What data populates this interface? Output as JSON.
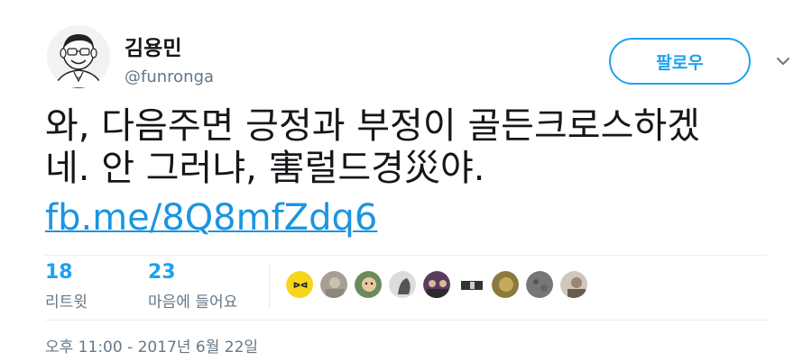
{
  "author": {
    "name": "김용민",
    "handle": "@funronga"
  },
  "follow_label": "팔로우",
  "tweet": {
    "text_line1": "와, 다음주면 긍정과 부정이 골든크로스하겠",
    "text_line2": "네. 안 그러냐, 害럴드경災야.",
    "link": "fb.me/8Q8mfZdq6"
  },
  "stats": {
    "retweets": {
      "count": "18",
      "label": "리트윗"
    },
    "likes": {
      "count": "23",
      "label": "마음에 들어요"
    }
  },
  "timestamp": "오후 11:00 - 2017년 6월 22일",
  "colors": {
    "accent": "#1da1f2",
    "link": "#1b95e0",
    "secondary_text": "#657786",
    "divider": "#e6ecf0"
  },
  "icons": {
    "caret": "chevron-down-icon",
    "liker_avatars": [
      "liker-avatar-yellow-logo",
      "liker-avatar-gray",
      "liker-avatar-cartoon",
      "liker-avatar-profile",
      "liker-avatar-group",
      "liker-avatar-dark",
      "liker-avatar-photo",
      "liker-avatar-moon",
      "liker-avatar-person"
    ]
  }
}
